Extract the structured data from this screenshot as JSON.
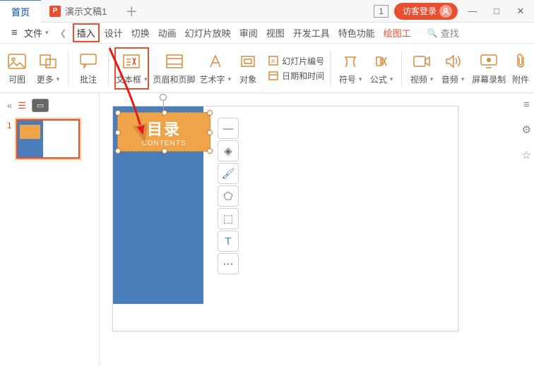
{
  "titlebar": {
    "home": "首页",
    "doc": "演示文稿1",
    "doc_icon": "P",
    "add": "＋",
    "count": "1",
    "login": "访客登录",
    "minimize": "—",
    "maximize": "□",
    "close": "✕"
  },
  "menubar": {
    "file": "文件",
    "file_arrow": "▾",
    "prev": "❮",
    "items": [
      "插入",
      "设计",
      "切换",
      "动画",
      "幻灯片放映",
      "审阅",
      "视图",
      "开发工具",
      "特色功能",
      "绘图工"
    ],
    "search": "查找"
  },
  "ribbon": {
    "keimg": "可图",
    "more": "更多",
    "comment": "批注",
    "textbox": "文本框",
    "header_footer": "页眉和页脚",
    "wordart": "艺术字",
    "object": "对象",
    "slide_num": "幻灯片编号",
    "datetime": "日期和时间",
    "symbol": "符号",
    "formula": "公式",
    "video": "视频",
    "audio": "音频",
    "screen_rec": "屏幕录制",
    "attach": "附件"
  },
  "thumb": {
    "num": "1"
  },
  "slide_text": {
    "title": "目录",
    "subtitle": "CONTENTS"
  },
  "left_tools": {
    "collapse": "«",
    "outline": "☰",
    "slide": "▭"
  },
  "float": [
    "—",
    "◈",
    "🖌",
    "⬠",
    "⬚",
    "T",
    "⋯"
  ],
  "right": [
    "≡",
    "⚙",
    "☆"
  ]
}
